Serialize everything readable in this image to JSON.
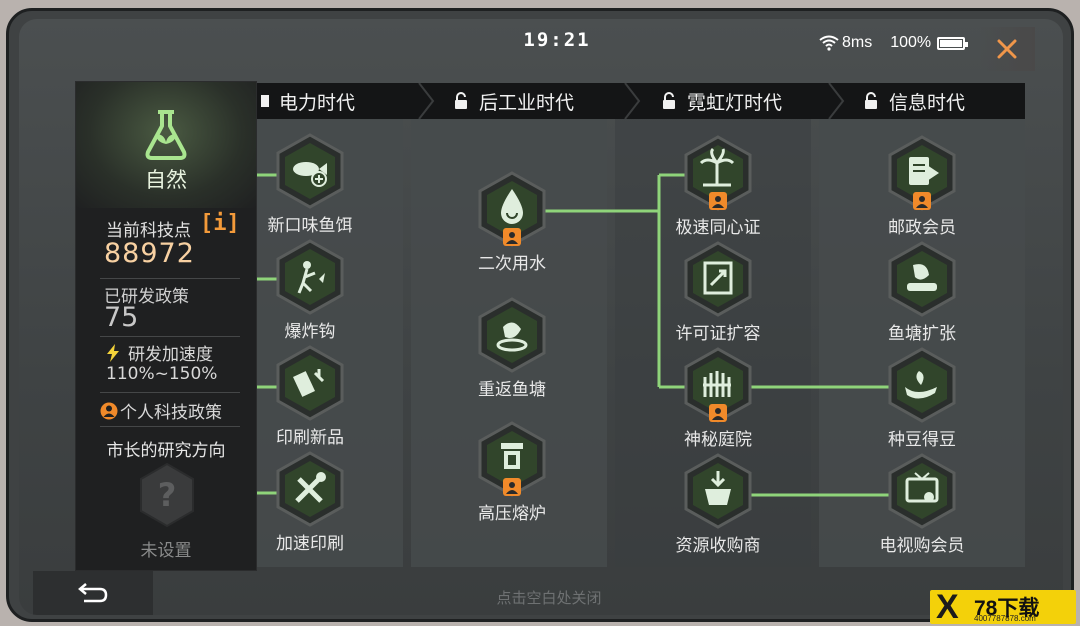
{
  "status": {
    "time": "19:21",
    "ping": "8ms",
    "battery": "100%"
  },
  "eras": [
    {
      "label": "电力时代",
      "locked": false
    },
    {
      "label": "后工业时代",
      "locked": true
    },
    {
      "label": "霓虹灯时代",
      "locked": true
    },
    {
      "label": "信息时代",
      "locked": true
    }
  ],
  "sidebar": {
    "category": "自然",
    "tech_points_label": "当前科技点",
    "info_button": "[i]",
    "tech_points_value": "88972",
    "researched_label": "已研发政策",
    "researched_value": "75",
    "speed_label": "研发加速度",
    "speed_value": "110%~150%",
    "personal_label": "个人科技政策",
    "mayor_direction": "市长的研究方向",
    "unset_label": "未设置"
  },
  "nodes": {
    "n1": {
      "label": "新口味鱼饵",
      "icon": "fish-bait-icon"
    },
    "n2": {
      "label": "爆炸钩",
      "icon": "hook-icon"
    },
    "n3": {
      "label": "印刷新品",
      "icon": "print-icon"
    },
    "n4": {
      "label": "加速印刷",
      "icon": "tools-icon"
    },
    "n5": {
      "label": "二次用水",
      "icon": "water-drop-icon"
    },
    "n6": {
      "label": "重返鱼塘",
      "icon": "fish-icon"
    },
    "n7": {
      "label": "高压熔炉",
      "icon": "furnace-icon"
    },
    "n8": {
      "label": "极速同心证",
      "icon": "palm-icon"
    },
    "n9": {
      "label": "许可证扩容",
      "icon": "license-icon"
    },
    "n10": {
      "label": "神秘庭院",
      "icon": "garden-icon"
    },
    "n11": {
      "label": "资源收购商",
      "icon": "basket-icon"
    },
    "n12": {
      "label": "邮政会员",
      "icon": "vip-icon"
    },
    "n13": {
      "label": "鱼塘扩张",
      "icon": "pond-icon"
    },
    "n14": {
      "label": "种豆得豆",
      "icon": "hand-seed-icon"
    },
    "n15": {
      "label": "电视购会员",
      "icon": "tv-icon"
    }
  },
  "footer_hint": "点击空白处关闭",
  "watermark": {
    "mark": "X",
    "text": "78下载",
    "url": "4007787878.com"
  },
  "colors": {
    "accent": "#8fd47a",
    "hex_fill": "#2a3a26",
    "hex_border": "#626563",
    "badge": "#f08a2a",
    "line": "#8fd47a"
  }
}
